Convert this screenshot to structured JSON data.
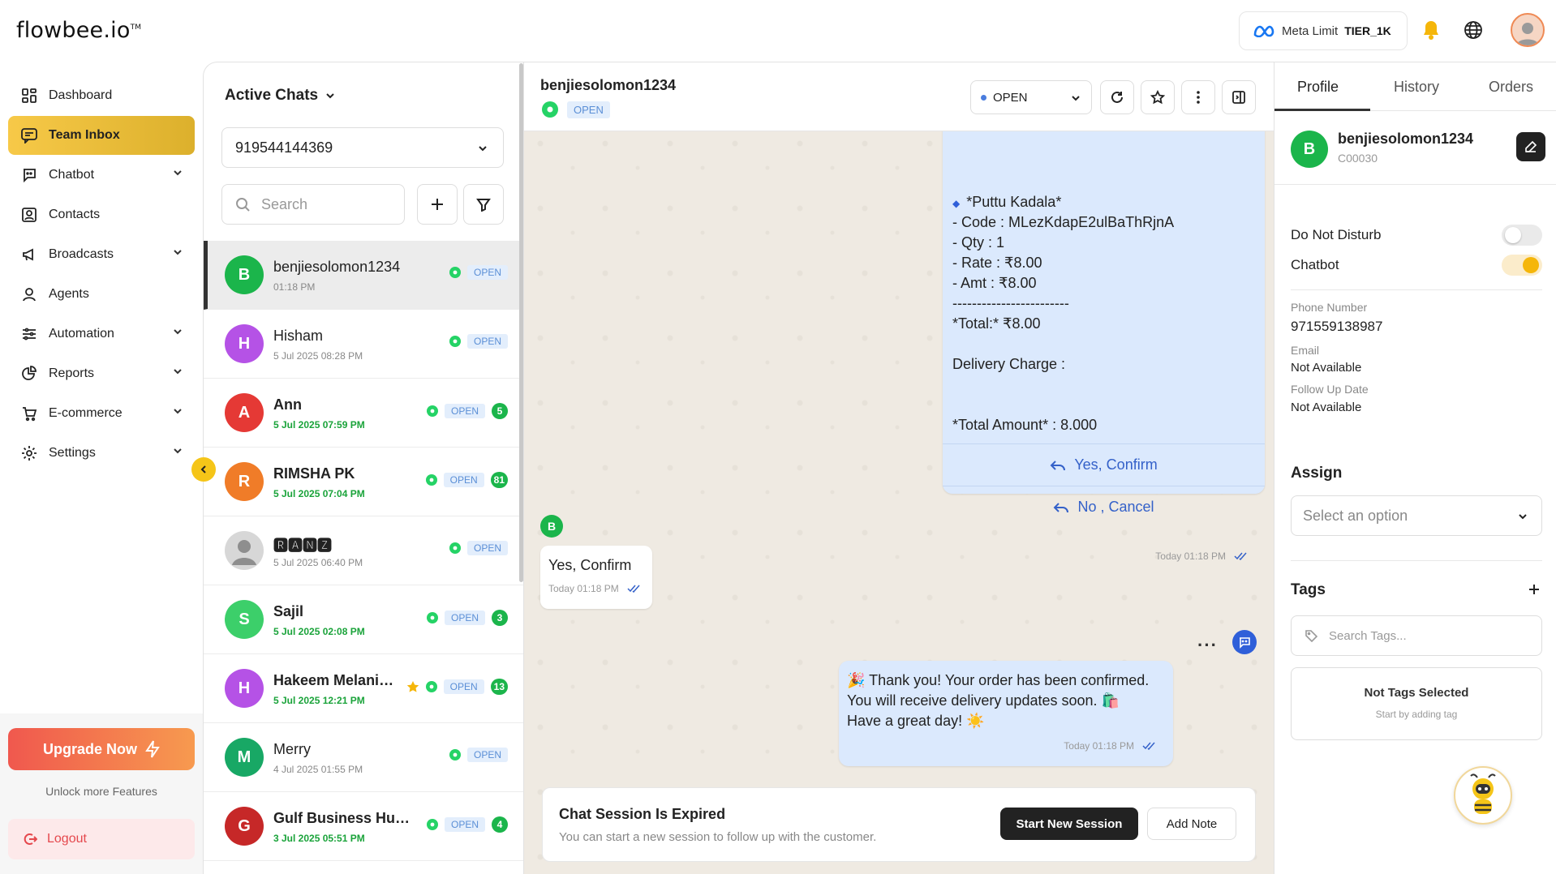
{
  "brand": {
    "logo_text": "flowbee.io",
    "logo_mark": "TM"
  },
  "topbar": {
    "meta_label": "Meta Limit",
    "meta_tier": "TIER_1K"
  },
  "sidebar": {
    "items": [
      {
        "label": "Dashboard"
      },
      {
        "label": "Team Inbox"
      },
      {
        "label": "Chatbot"
      },
      {
        "label": "Contacts"
      },
      {
        "label": "Broadcasts"
      },
      {
        "label": "Agents"
      },
      {
        "label": "Automation"
      },
      {
        "label": "Reports"
      },
      {
        "label": "E-commerce"
      },
      {
        "label": "Settings"
      }
    ],
    "upgrade_label": "Upgrade Now",
    "unlock_text": "Unlock more Features",
    "logout_label": "Logout"
  },
  "chatlist": {
    "title": "Active Chats",
    "phone": "919544144369",
    "search_placeholder": "Search",
    "rows": [
      {
        "initial": "B",
        "name": "benjiesolomon1234",
        "time": "01:18 PM",
        "status": "OPEN",
        "count": "",
        "color": "#1bb54b"
      },
      {
        "initial": "H",
        "name": "Hisham",
        "time": "5 Jul 2025 08:28 PM",
        "status": "OPEN",
        "count": "",
        "color": "#b552e6"
      },
      {
        "initial": "A",
        "name": "Ann",
        "time": "5 Jul 2025 07:59 PM",
        "status": "OPEN",
        "count": "5",
        "color": "#e53935"
      },
      {
        "initial": "R",
        "name": "RIMSHA PK",
        "time": "5 Jul 2025 07:04 PM",
        "status": "OPEN",
        "count": "81",
        "color": "#f07c28"
      },
      {
        "initial": "",
        "name": "🆁🅰🅽🆉",
        "time": "5 Jul 2025 06:40 PM",
        "status": "OPEN",
        "count": "",
        "color": "#cfcfcf"
      },
      {
        "initial": "S",
        "name": "Sajil",
        "time": "5 Jul 2025 02:08 PM",
        "status": "OPEN",
        "count": "3",
        "color": "#3ccf6a"
      },
      {
        "initial": "H",
        "name": "Hakeem Melanikkal",
        "time": "5 Jul 2025 12:21 PM",
        "status": "OPEN",
        "count": "13",
        "color": "#b552e6"
      },
      {
        "initial": "M",
        "name": "Merry",
        "time": "4 Jul 2025 01:55 PM",
        "status": "OPEN",
        "count": "",
        "color": "#18a865"
      },
      {
        "initial": "G",
        "name": "Gulf Business Hub Qatar",
        "time": "3 Jul 2025 05:51 PM",
        "status": "OPEN",
        "count": "4",
        "color": "#c62828"
      }
    ]
  },
  "chat": {
    "contact_name": "benjiesolomon1234",
    "status_badge": "OPEN",
    "status_select": "OPEN",
    "order_lines": [
      "*Puttu Kadala*",
      "- Code : MLezKdapE2ulBaThRjnA",
      "- Qty : 1",
      "- Rate : ₹8.00",
      "- Amt : ₹8.00",
      "------------------------",
      "*Total:* ₹8.00",
      "Delivery Charge :",
      "*Total Amount* : 8.000"
    ],
    "quick_reply_1": "Yes, Confirm",
    "quick_reply_2": "No , Cancel",
    "order_time": "Today 01:18 PM",
    "incoming_initial": "B",
    "incoming_text": "Yes, Confirm",
    "incoming_time": "Today 01:18 PM",
    "outgoing_lines": [
      "🎉 Thank you! Your order has been confirmed.",
      "You will receive delivery updates soon. 🛍️",
      "Have a great day! ☀️"
    ],
    "outgoing_time": "Today 01:18 PM",
    "session_title": "Chat Session Is Expired",
    "session_text": "You can start a new session to follow up with the customer.",
    "start_session_label": "Start New Session",
    "add_note_label": "Add Note"
  },
  "profile": {
    "tabs": [
      "Profile",
      "History",
      "Orders"
    ],
    "initial": "B",
    "name": "benjiesolomon1234",
    "code": "C00030",
    "dnd_label": "Do Not Disturb",
    "dnd_on": false,
    "chatbot_label": "Chatbot",
    "chatbot_on": true,
    "phone_label": "Phone Number",
    "phone_value": "971559138987",
    "email_label": "Email",
    "email_value": "Not Available",
    "followup_label": "Follow Up Date",
    "followup_value": "Not Available",
    "assign_title": "Assign",
    "assign_placeholder": "Select an option",
    "tags_title": "Tags",
    "tags_search_placeholder": "Search Tags...",
    "no_tags_title": "Not Tags Selected",
    "no_tags_sub": "Start by adding tag"
  },
  "colors": {
    "accent": "#f5c518",
    "whatsapp": "#25d366",
    "open_badge_bg": "#e3eefc",
    "link_blue": "#3461c9"
  }
}
